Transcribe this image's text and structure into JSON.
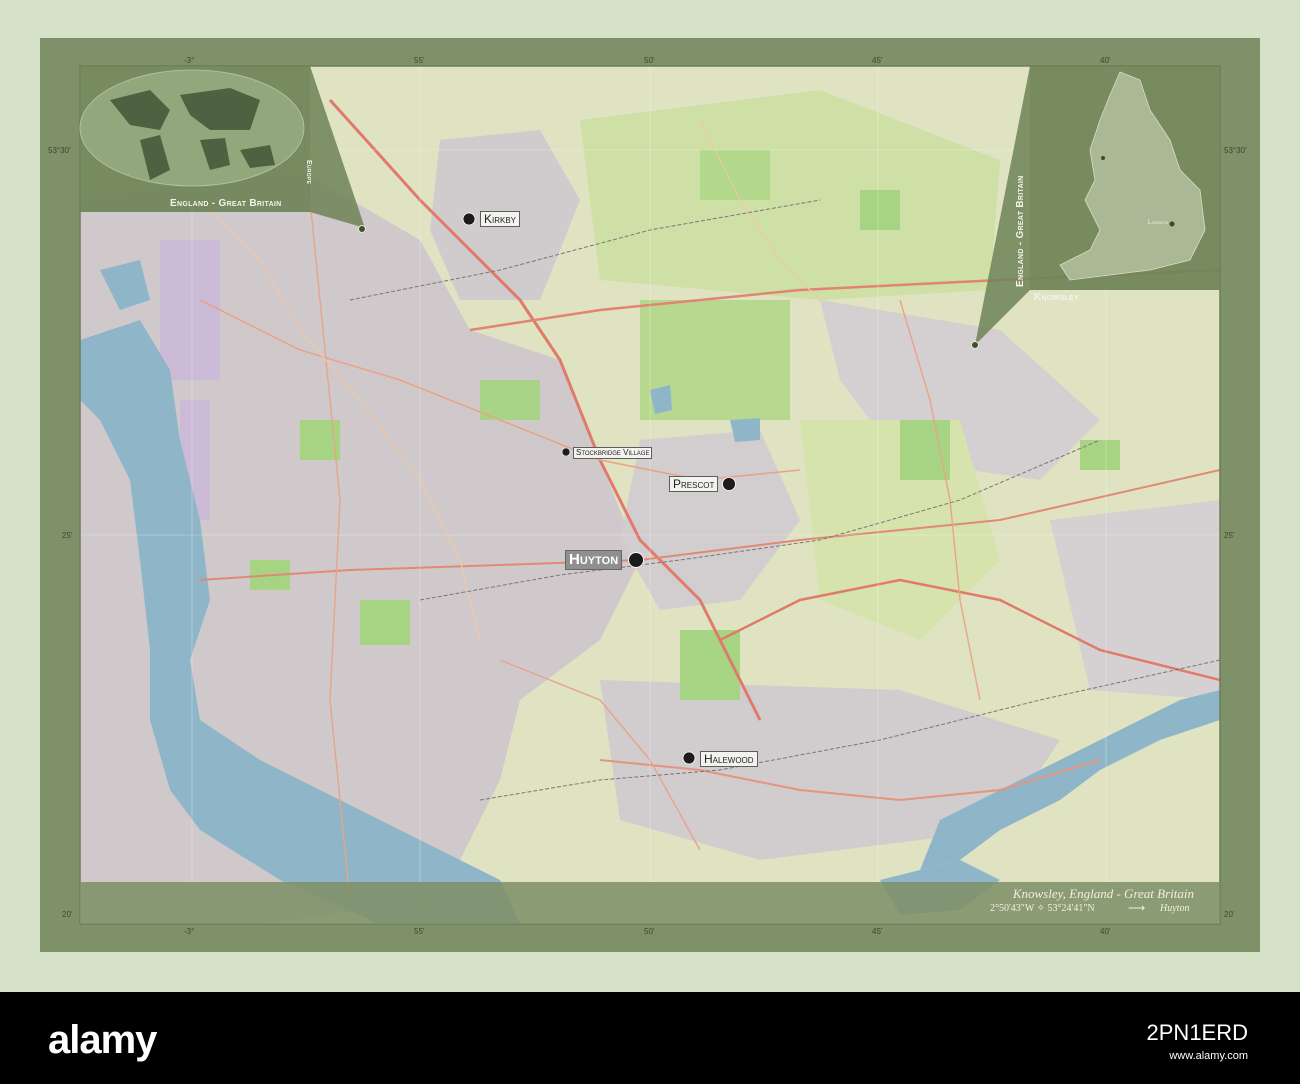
{
  "map": {
    "title": "Knowsley, England - Great Britain",
    "coordinates": "2°50'43\"W ✧ 53°24'41\"N",
    "capital_arrow": "⟶",
    "capital": "Huyton",
    "places": [
      {
        "name": "Kirkby"
      },
      {
        "name": "Stockbridge Village"
      },
      {
        "name": "Prescot"
      },
      {
        "name": "Huyton"
      },
      {
        "name": "Halewood"
      }
    ],
    "inset_world": {
      "label": "England - Great Britain",
      "continent": "Europe"
    },
    "inset_country": {
      "label": "England - Great Britain",
      "region": "Knowsley",
      "city": "London"
    },
    "grid_labels": {
      "lon_top_left": "-3°",
      "lon_top_mid": "50'",
      "lon_top_45": "45'",
      "lon_top_right": "40'",
      "lon_bottom_left": "-3°",
      "lon_bottom_mid": "50'",
      "lon_bottom_45": "45'",
      "lon_bottom_right": "40'",
      "lon_top_55": "55'",
      "lon_bottom_55": "55'",
      "lat_upper_left": "53°30'",
      "lat_upper_right": "53°30'",
      "lat_lower_left": "20'",
      "lat_lower_right": "20'",
      "lat_mid_left": "25'",
      "lat_mid_right": "25'"
    },
    "colors": {
      "water": "#8fb6c8",
      "land": "#dfe3c2",
      "frame": "#7f9168",
      "urban": "#c7c3c7",
      "park": "#9fcc7a"
    }
  },
  "watermark": {
    "logo": "alamy",
    "image_id": "2PN1ERD",
    "line": "www.alamy.com"
  }
}
